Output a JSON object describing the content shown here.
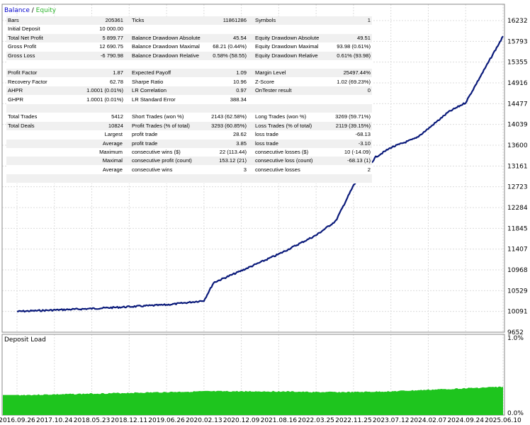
{
  "legend": {
    "balance": "Balance",
    "separator": " / ",
    "equity": "Equity"
  },
  "deposit_label": "Deposit Load",
  "colors": {
    "balance": "#0a1a7a",
    "deposit": "#1ec51e",
    "grid": "#dcdcdc",
    "border": "#888888",
    "equity_text": "#2cb52c",
    "balance_text": "#0000cc"
  },
  "stats": {
    "rows": [
      {
        "shade": true,
        "c0": "Bars",
        "c1": "205361",
        "c2": "Ticks",
        "c3": "11861286",
        "c4": "Symbols",
        "c5": "1"
      },
      {
        "shade": false,
        "c0": "Initial Deposit",
        "c1": "10 000.00",
        "c2": "",
        "c3": "",
        "c4": "",
        "c5": ""
      },
      {
        "shade": true,
        "c0": "Total Net Profit",
        "c1": "5 899.77",
        "c2": "Balance Drawdown Absolute",
        "c3": "45.54",
        "c4": "Equity Drawdown Absolute",
        "c5": "49.51"
      },
      {
        "shade": false,
        "c0": "Gross Profit",
        "c1": "12 690.75",
        "c2": "Balance Drawdown Maximal",
        "c3": "68.21 (0.44%)",
        "c4": "Equity Drawdown Maximal",
        "c5": "93.98 (0.61%)"
      },
      {
        "shade": true,
        "c0": "Gross Loss",
        "c1": "-6 790.98",
        "c2": "Balance Drawdown Relative",
        "c3": "0.58% (58.55)",
        "c4": "Equity Drawdown Relative",
        "c5": "0.61% (93.98)"
      },
      {
        "shade": false,
        "c0": "",
        "c1": "",
        "c2": "",
        "c3": "",
        "c4": "",
        "c5": ""
      },
      {
        "shade": true,
        "c0": "Profit Factor",
        "c1": "1.87",
        "c2": "Expected Payoff",
        "c3": "1.09",
        "c4": "Margin Level",
        "c5": "25497.44%"
      },
      {
        "shade": false,
        "c0": "Recovery Factor",
        "c1": "62.78",
        "c2": "Sharpe Ratio",
        "c3": "10.96",
        "c4": "Z-Score",
        "c5": "1.02 (69.23%)"
      },
      {
        "shade": true,
        "c0": "AHPR",
        "c1": "1.0001 (0.01%)",
        "c2": "LR Correlation",
        "c3": "0.97",
        "c4": "OnTester result",
        "c5": "0"
      },
      {
        "shade": false,
        "c0": "GHPR",
        "c1": "1.0001 (0.01%)",
        "c2": "LR Standard Error",
        "c3": "388.34",
        "c4": "",
        "c5": ""
      },
      {
        "shade": true,
        "c0": "",
        "c1": "",
        "c2": "",
        "c3": "",
        "c4": "",
        "c5": ""
      },
      {
        "shade": false,
        "c0": "Total Trades",
        "c1": "5412",
        "c2": "Short Trades (won %)",
        "c3": "2143 (62.58%)",
        "c4": "Long Trades (won %)",
        "c5": "3269 (59.71%)"
      },
      {
        "shade": true,
        "c0": "Total Deals",
        "c1": "10824",
        "c2": "Profit Trades (% of total)",
        "c3": "3293 (60.85%)",
        "c4": "Loss Trades (% of total)",
        "c5": "2119 (39.15%)"
      },
      {
        "shade": false,
        "c0": "",
        "c1": "",
        "c0r": "Largest",
        "c2": "profit trade",
        "c3": "28.62",
        "c4": "loss trade",
        "c5": "-68.13"
      },
      {
        "shade": true,
        "c0": "",
        "c1": "",
        "c0r": "Average",
        "c2": "profit trade",
        "c3": "3.85",
        "c4": "loss trade",
        "c5": "-3.10"
      },
      {
        "shade": false,
        "c0": "",
        "c1": "",
        "c0r": "Maximum",
        "c2": "consecutive wins ($)",
        "c3": "22 (113.44)",
        "c4": "consecutive losses ($)",
        "c5": "10 (-14.09)"
      },
      {
        "shade": true,
        "c0": "",
        "c1": "",
        "c0r": "Maximal",
        "c2": "consecutive profit (count)",
        "c3": "153.12 (21)",
        "c4": "consecutive loss (count)",
        "c5": "-68.13 (1)"
      },
      {
        "shade": false,
        "c0": "",
        "c1": "",
        "c0r": "Average",
        "c2": "consecutive wins",
        "c3": "3",
        "c4": "consecutive losses",
        "c5": "2"
      },
      {
        "shade": true,
        "c0": "",
        "c1": "",
        "c2": "",
        "c3": "",
        "c4": "",
        "c5": ""
      }
    ]
  },
  "chart_data": [
    {
      "type": "line",
      "title": "",
      "series": [
        {
          "name": "Balance",
          "x": [
            "2016.09.26",
            "2017.10.24",
            "2018.05.23",
            "2018.12.11",
            "2019.06.26",
            "2019.10.15",
            "2020.02.13",
            "2020.05.01",
            "2020.12.09",
            "2021.08.16",
            "2022.03.25",
            "2022.08.01",
            "2022.11.25",
            "2023.04.10",
            "2023.07.12",
            "2023.12.01",
            "2024.02.07",
            "2024.06.10",
            "2024.09.24",
            "2025.06.10"
          ],
          "values": [
            10090,
            10120,
            10150,
            10190,
            10230,
            10270,
            10320,
            10700,
            10950,
            11300,
            11700,
            12000,
            12750,
            13350,
            13550,
            13750,
            13950,
            14300,
            14500,
            15900
          ]
        }
      ],
      "yticks": [
        "16232",
        "15793",
        "15355",
        "14916",
        "14477",
        "14039",
        "13600",
        "13161",
        "12723",
        "12284",
        "11845",
        "11407",
        "10968",
        "10529",
        "10091",
        "9652"
      ],
      "xticks": [
        "2016.09.26",
        "2017.10.24",
        "2018.05.23",
        "2018.12.11",
        "2019.06.26",
        "2020.02.13",
        "2020.12.09",
        "2021.08.16",
        "2022.03.25",
        "2022.11.25",
        "2023.07.12",
        "2024.02.07",
        "2024.09.24",
        "2025.06.10"
      ],
      "ylim": [
        9652,
        16232
      ],
      "legend": "top-left",
      "grid": true
    },
    {
      "type": "area",
      "title": "",
      "series": [
        {
          "name": "Deposit Load",
          "x": [
            "2016.09.26",
            "2017.10.24",
            "2018.05.23",
            "2018.12.11",
            "2019.06.26",
            "2020.02.13",
            "2020.12.09",
            "2021.08.16",
            "2022.03.25",
            "2022.11.25",
            "2023.07.12",
            "2024.02.07",
            "2024.09.24",
            "2025.06.10"
          ],
          "values": [
            0.26,
            0.27,
            0.28,
            0.29,
            0.3,
            0.31,
            0.31,
            0.31,
            0.3,
            0.3,
            0.31,
            0.33,
            0.35,
            0.37
          ]
        }
      ],
      "yticks": [
        "1.0%",
        "0.0%"
      ],
      "ylim": [
        0,
        1.0
      ],
      "legend": "top-left",
      "grid": true
    }
  ]
}
